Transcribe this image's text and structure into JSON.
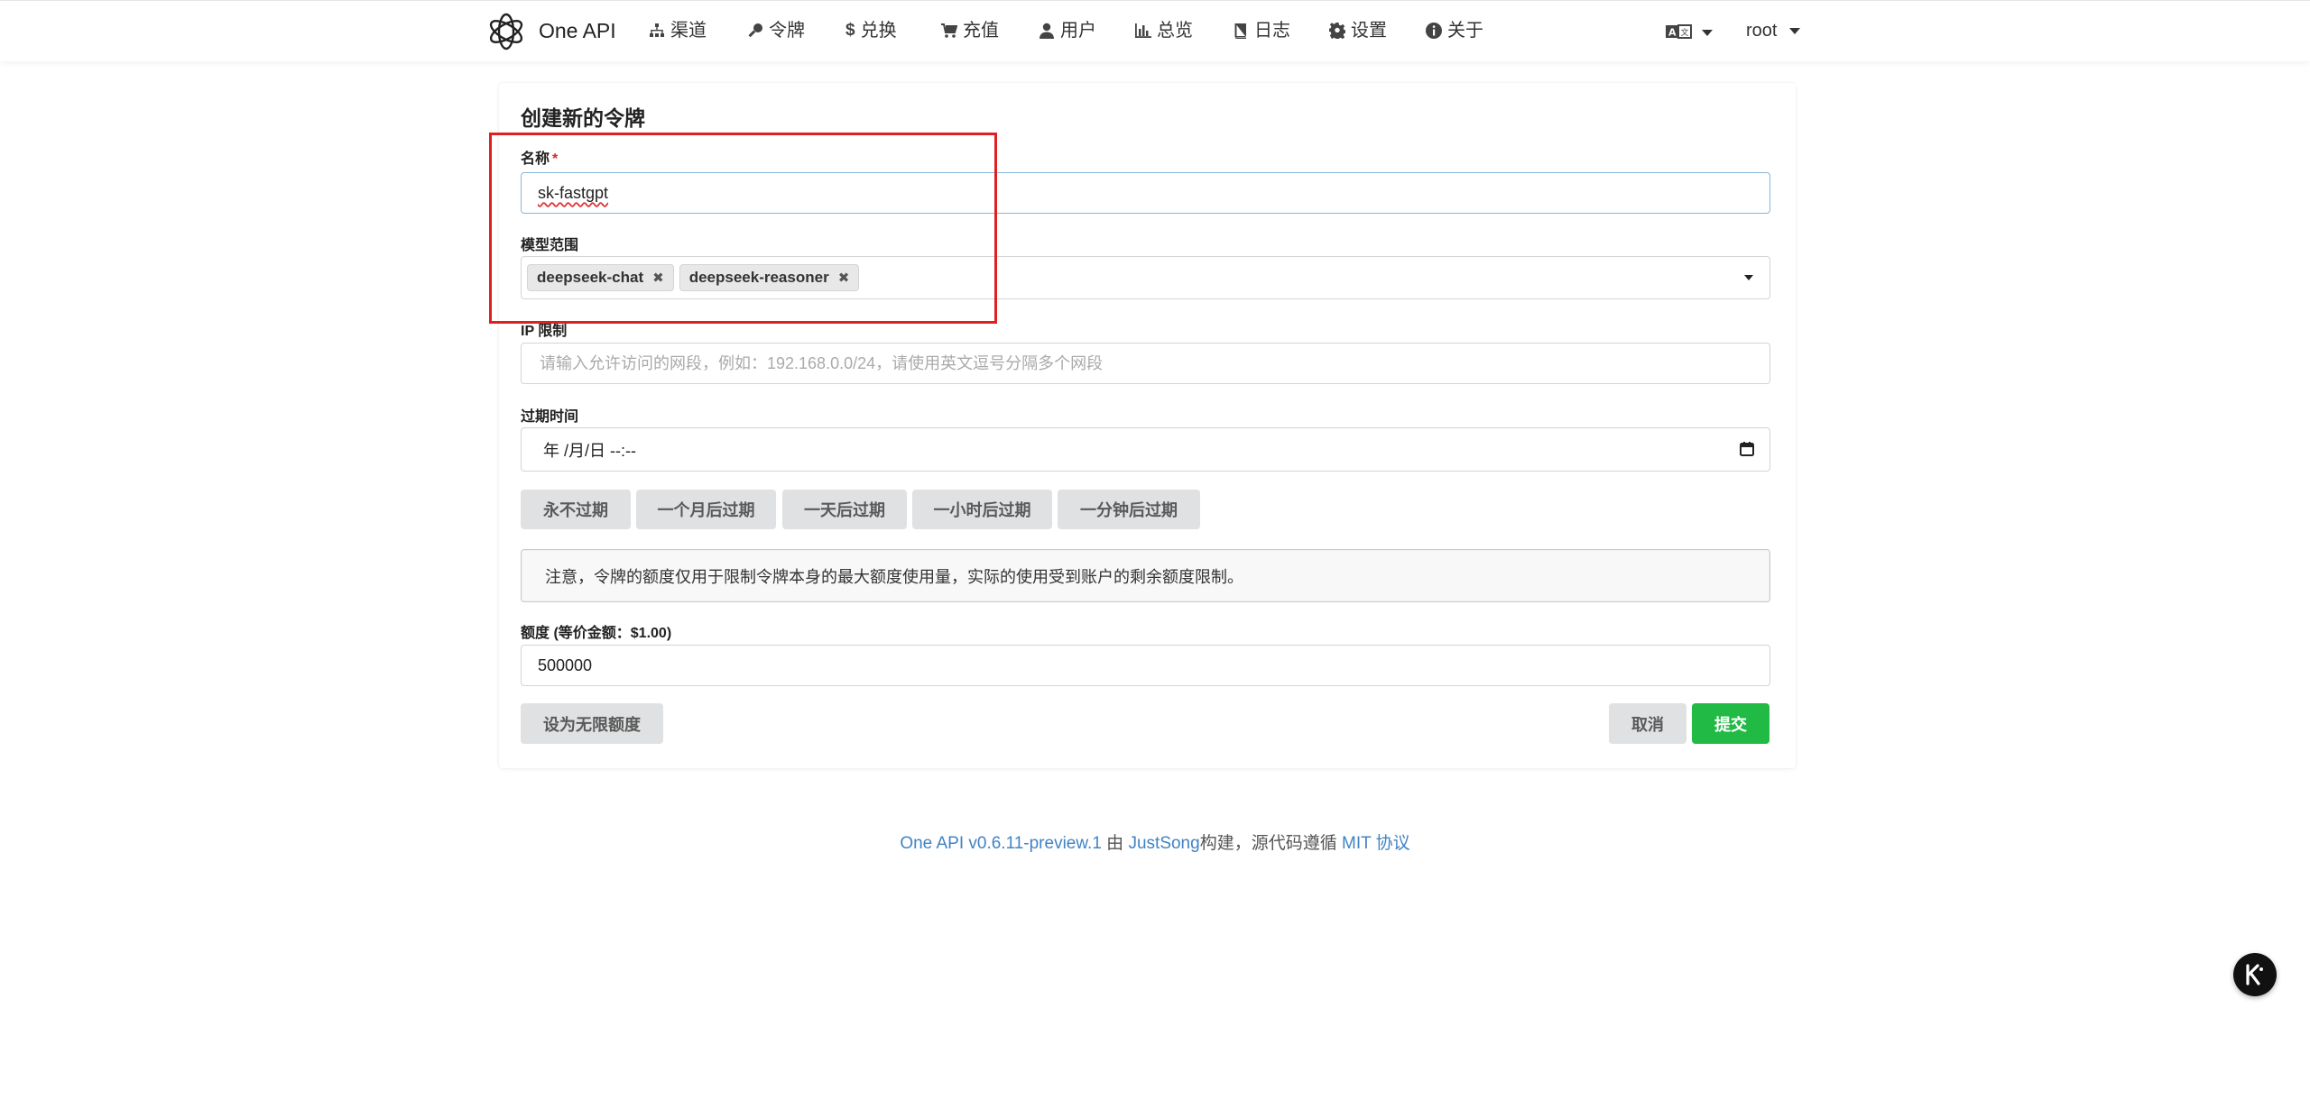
{
  "nav": {
    "brand": "One API",
    "items": [
      {
        "label": "渠道",
        "icon": "sitemap-icon"
      },
      {
        "label": "令牌",
        "icon": "key-icon"
      },
      {
        "label": "兑换",
        "icon": "dollar-icon"
      },
      {
        "label": "充值",
        "icon": "cart-icon"
      },
      {
        "label": "用户",
        "icon": "user-icon"
      },
      {
        "label": "总览",
        "icon": "bar-chart-icon"
      },
      {
        "label": "日志",
        "icon": "book-icon"
      },
      {
        "label": "设置",
        "icon": "gear-icon"
      },
      {
        "label": "关于",
        "icon": "info-icon"
      }
    ],
    "user": "root"
  },
  "form": {
    "title": "创建新的令牌",
    "name_label": "名称",
    "name_required_mark": "*",
    "name_value": "sk-fastgpt",
    "models_label": "模型范围",
    "models": [
      "deepseek-chat",
      "deepseek-reasoner"
    ],
    "ip_label": "IP 限制",
    "ip_placeholder": "请输入允许访问的网段，例如：192.168.0.0/24，请使用英文逗号分隔多个网段",
    "expire_label": "过期时间",
    "expire_value": "年 /月/日 --:--",
    "expire_buttons": [
      "永不过期",
      "一个月后过期",
      "一天后过期",
      "一小时后过期",
      "一分钟后过期"
    ],
    "notice": "注意，令牌的额度仅用于限制令牌本身的最大额度使用量，实际的使用受到账户的剩余额度限制。",
    "quota_label": "额度 (等价金额：$1.00)",
    "quota_value": "500000",
    "unlimited_button": "设为无限额度",
    "cancel_button": "取消",
    "submit_button": "提交"
  },
  "footer": {
    "version_link": "One API v0.6.11-preview.1",
    "by": "由",
    "author_link": "JustSong",
    "built": "构建，源代码遵循",
    "license_link": "MIT 协议"
  },
  "colors": {
    "accent_green": "#21ba45",
    "link_blue": "#4183c4",
    "highlight_red": "#e02020"
  }
}
